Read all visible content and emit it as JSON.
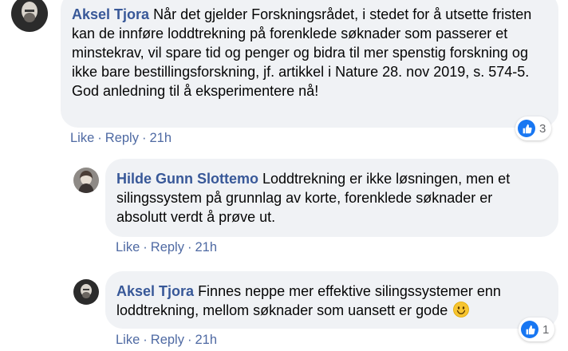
{
  "comments": [
    {
      "author": "Aksel Tjora",
      "text": "Når det gjelder Forskningsrådet, i stedet for å utsette fristen kan de innføre loddtrekning på forenklede søknader som passerer et minstekrav, vil spare tid og penger og bidra til mer spenstig forskning og ikke bare bestillingsforskning, jf. artikkel i Nature 28. nov 2019, s. 574-5. God anledning til å eksperimentere nå!",
      "like_label": "Like",
      "reply_label": "Reply",
      "time": "21h",
      "reaction_count": "3",
      "reaction_icon": "like-icon",
      "accent": "#385898"
    },
    {
      "author": "Hilde Gunn Slottemo",
      "text": "Loddtrekning er ikke løsningen, men et silingssystem på grunnlag av korte, forenklede søknader er absolutt verdt å prøve ut.",
      "like_label": "Like",
      "reply_label": "Reply",
      "time": "21h"
    },
    {
      "author": "Aksel Tjora",
      "text": "Finnes neppe mer effektive silingssystemer enn loddtrekning, mellom søknader som uansett er gode",
      "emoji": "smiley-emoji",
      "like_label": "Like",
      "reply_label": "Reply",
      "time": "21h",
      "reaction_count": "1",
      "reaction_icon": "like-icon"
    }
  ],
  "colors": {
    "bubble": "#f0f2f5",
    "author": "#385898",
    "action": "#4f6aa3",
    "like_blue": "#1877f2"
  }
}
